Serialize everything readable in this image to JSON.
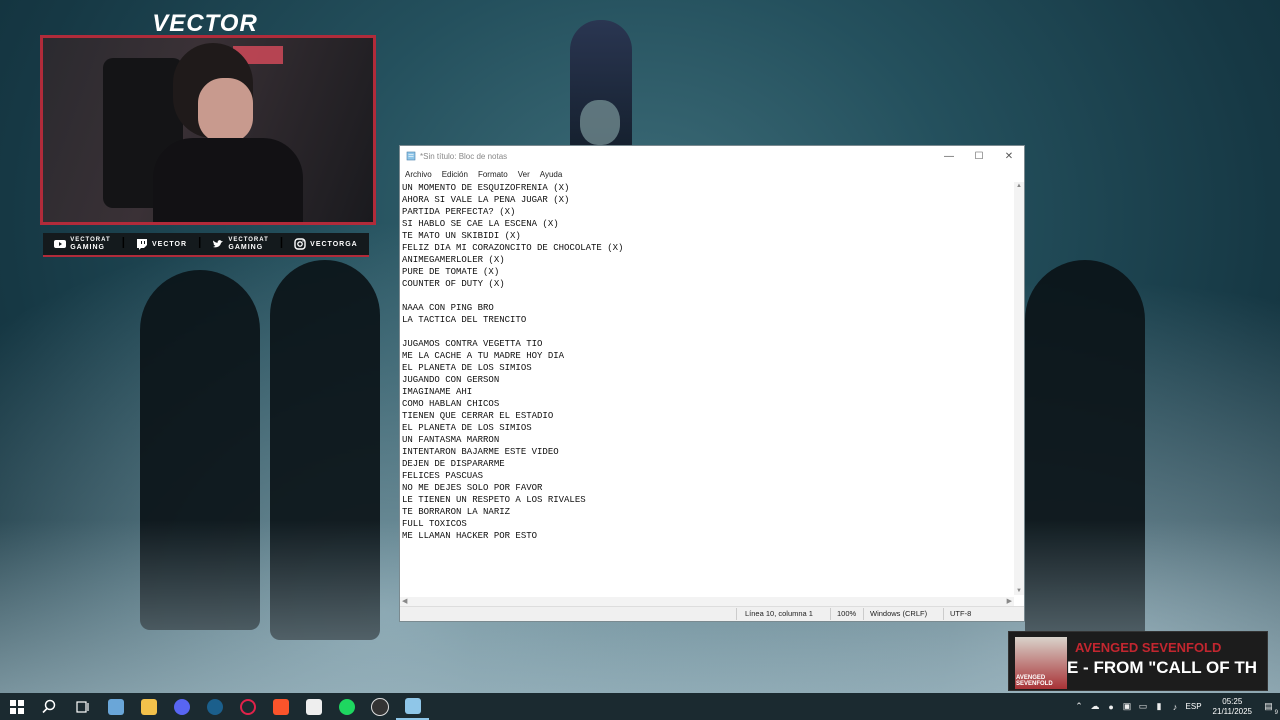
{
  "webcam": {
    "overlay_title": "VECTOR",
    "socials": [
      {
        "icon": "youtube-icon",
        "line1": "VECTORAT",
        "line2": "GAMING"
      },
      {
        "icon": "twitch-icon",
        "line1": "VECTOR",
        "line2": ""
      },
      {
        "icon": "twitter-icon",
        "line1": "VECTORAT",
        "line2": "GAMING"
      },
      {
        "icon": "instagram-icon",
        "line1": "VECTORGA",
        "line2": ""
      }
    ],
    "separator": "I"
  },
  "notepad": {
    "window_title": "*Sin título: Bloc de notas",
    "menu": [
      "Archivo",
      "Edición",
      "Formato",
      "Ver",
      "Ayuda"
    ],
    "content": "UN MOMENTO DE ESQUIZOFRENIA (X)\nAHORA SI VALE LA PENA JUGAR (X)\nPARTIDA PERFECTA? (X)\nSI HABLO SE CAE LA ESCENA (X)\nTE MATO UN SKIBIDI (X)\nFELIZ DIA MI CORAZONCITO DE CHOCOLATE (X)\nANIMEGAMERLOLER (X)\nPURE DE TOMATE (X)\nCOUNTER OF DUTY (X)\n\nNAAA CON PING BRO\nLA TACTICA DEL TRENCITO\n\nJUGAMOS CONTRA VEGETTA TIO\nME LA CACHE A TU MADRE HOY DIA\nEL PLANETA DE LOS SIMIOS\nJUGANDO CON GERSON\nIMAGINAME AHI\nCOMO HABLAN CHICOS\nTIENEN QUE CERRAR EL ESTADIO\nEL PLANETA DE LOS SIMIOS\nUN FANTASMA MARRON\nINTENTARON BAJARME ESTE VIDEO\nDEJEN DE DISPARARME\nFELICES PASCUAS\nNO ME DEJES SOLO POR FAVOR\nLE TIENEN UN RESPETO A LOS RIVALES\nTE BORRARON LA NARIZ\nFULL TOXICOS\nME LLAMAN HACKER POR ESTO",
    "status": {
      "position": "Línea 10, columna 1",
      "zoom": "100%",
      "line_ending": "Windows (CRLF)",
      "encoding": "UTF-8"
    },
    "controls": {
      "minimize": "—",
      "maximize": "☐",
      "close": "✕"
    }
  },
  "now_playing": {
    "artist": "AVENGED SEVENFOLD",
    "song": "E - FROM \"CALL OF TH",
    "art_text_line1": "AVENGED",
    "art_text_line2": "SEVENFOLD"
  },
  "taskbar": {
    "apps": [
      {
        "name": "start-button",
        "color": "#ffffff"
      },
      {
        "name": "search-button",
        "color": "#ffffff"
      },
      {
        "name": "task-view-button",
        "color": "#ffffff"
      },
      {
        "name": "file-explorer-icon",
        "color": "#6aa6d8"
      },
      {
        "name": "folder-icon",
        "color": "#f3c14b"
      },
      {
        "name": "discord-icon",
        "color": "#5865f2"
      },
      {
        "name": "steam-icon",
        "color": "#1b5f8c"
      },
      {
        "name": "opera-icon",
        "color": "#e0224a"
      },
      {
        "name": "brave-icon",
        "color": "#fb542b"
      },
      {
        "name": "game-launcher-icon",
        "color": "#222222"
      },
      {
        "name": "spotify-icon",
        "color": "#1ed760"
      },
      {
        "name": "obs-icon",
        "color": "#333333"
      },
      {
        "name": "notepad-icon",
        "color": "#8fc6e8"
      }
    ],
    "language": "ESP",
    "time": "05:25",
    "date": "21/11/2025",
    "notification_count": "9"
  }
}
